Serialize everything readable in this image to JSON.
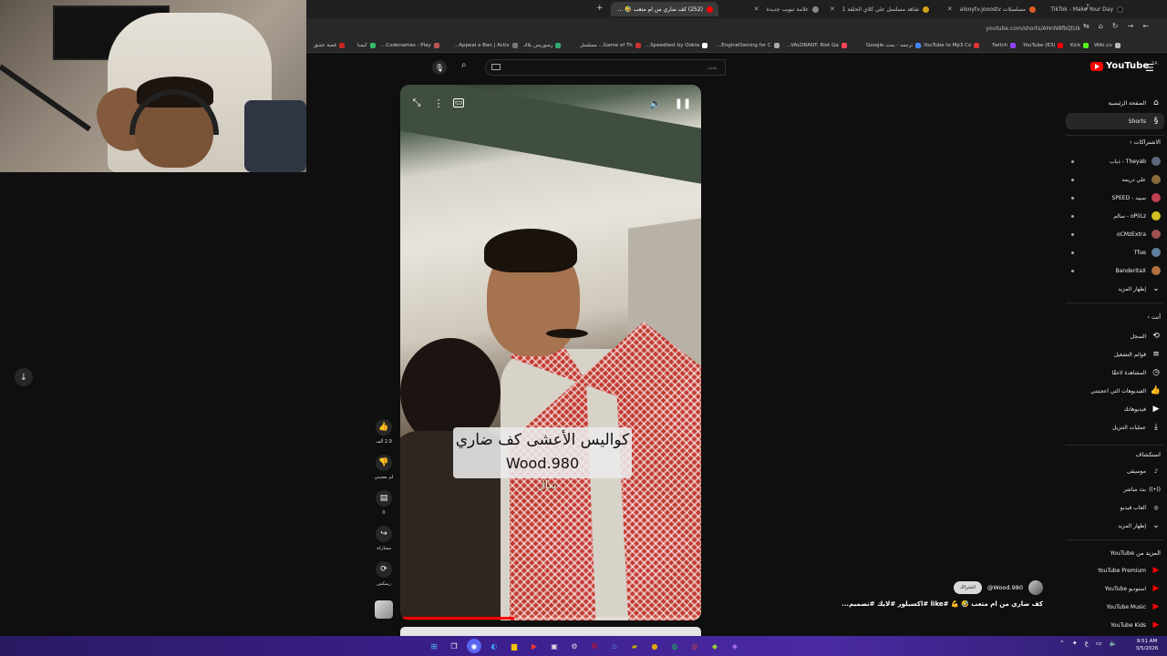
{
  "browser": {
    "tabs": [
      {
        "title": "TikTok - Make Your Day",
        "color": "#111111",
        "active": false
      },
      {
        "title": "مسلسلات alooytv.jooostv",
        "color": "#e05a2b",
        "active": false
      },
      {
        "title": "شاهد مسلسل علي كلاي الحلقة 1",
        "color": "#d4a017",
        "active": false
      },
      {
        "title": "علامة تبويب جديدة",
        "color": "#888888",
        "active": false
      },
      {
        "title": "(252) كف ضاري من ام متعب 🤣 ...",
        "color": "#ff0000",
        "active": true
      }
    ],
    "new_tab": "+",
    "url": "youtube.com/shorts/AHnN8fbQtUk",
    "bookmarks": [
      {
        "label": "YouTube to Mp3 Co...",
        "color": "#d33"
      },
      {
        "label": "ترجمه - بحث Google",
        "color": "#4285f4"
      },
      {
        "label": "VALORANT: Riot Ga...",
        "color": "#ff4655"
      },
      {
        "label": "EngineOwning for C...",
        "color": "#aaa"
      },
      {
        "label": "Speedtest by Ookla...",
        "color": "#fff"
      },
      {
        "label": "Game of Th... مسلسل",
        "color": "#c33"
      },
      {
        "label": "زمبوريس بلاك",
        "color": "#3a7"
      },
      {
        "label": "Appeal a Ban | Activ...",
        "color": "#777"
      },
      {
        "label": "Codenames - Play...",
        "color": "#b55"
      },
      {
        "label": "كيمنا",
        "color": "#3b6"
      },
      {
        "label": "قصة عشق",
        "color": "#c22"
      },
      {
        "label": "Twitch",
        "color": "#9146ff"
      },
      {
        "label": "(63) YouTube",
        "color": "#ff0000"
      },
      {
        "label": "Kick",
        "color": "#53fc18"
      },
      {
        "label": "Wiki.co",
        "color": "#bbb"
      }
    ]
  },
  "youtube": {
    "logo_text": "YouTube",
    "logo_country": "SA",
    "search_placeholder": "بحث",
    "search_value": "",
    "sidebar": {
      "home": "الصفحة الرئيسية",
      "shorts": "Shorts",
      "subscriptions_header": "الاشتراكات",
      "subscriptions": [
        {
          "name": "Theyab - ذياب",
          "color": "#5a6a7a"
        },
        {
          "name": "علي دريمه",
          "color": "#8a6a3a"
        },
        {
          "name": "سبيد - SPEED",
          "color": "#c04050"
        },
        {
          "name": "oPiiLz - سالم",
          "color": "#d0c020"
        },
        {
          "name": "oCMzExtra",
          "color": "#a05050"
        },
        {
          "name": "Tfue",
          "color": "#6080a0"
        },
        {
          "name": "BanderitaX",
          "color": "#b07040"
        }
      ],
      "show_more_subs": "إظهار المزيد",
      "you_header": "أنت",
      "you_items": [
        {
          "label": "السجل",
          "icon": "history-icon"
        },
        {
          "label": "قوائم التشغيل",
          "icon": "playlist-icon"
        },
        {
          "label": "المشاهدة لاحقًا",
          "icon": "clock-icon"
        },
        {
          "label": "الفيديوهات التي أعجبتني",
          "icon": "thumbs-up-icon"
        },
        {
          "label": "فيديوهاتك",
          "icon": "video-icon"
        },
        {
          "label": "عمليات التنزيل",
          "icon": "download-icon"
        }
      ],
      "explore_header": "استكشاف",
      "explore_items": [
        {
          "label": "موسيقى",
          "icon": "music-icon"
        },
        {
          "label": "بث مباشر",
          "icon": "live-icon"
        },
        {
          "label": "ألعاب فيديو",
          "icon": "gaming-icon"
        }
      ],
      "show_more_explore": "إظهار المزيد",
      "more_header": "المزيد من YouTube",
      "more_items": [
        {
          "label": "YouTube Premium"
        },
        {
          "label": "استوديو YouTube"
        },
        {
          "label": "YouTube Music"
        },
        {
          "label": "YouTube Kids"
        }
      ]
    },
    "video": {
      "caption_line1": "كواليس الأعشى كف ضاري",
      "caption_line2": "Wood.980",
      "subtitle": "تعال",
      "progress": 0.38
    },
    "actions": {
      "like_count": "2.9 ألف",
      "dislike_label": "لم يعجبني",
      "comments_count": "0",
      "share_label": "مشاركة",
      "remix_label": "ريمكس"
    },
    "channel": {
      "handle": "@Wood.980",
      "subscribe": "اشتراك"
    },
    "title": "كف ضاري من ام متعب 🤣 💪 #like #اكسبلور #لايك #تصميم..."
  },
  "taskbar": {
    "clock_time": "9:51 AM",
    "clock_date": "3/5/2026",
    "lang": "ع"
  }
}
